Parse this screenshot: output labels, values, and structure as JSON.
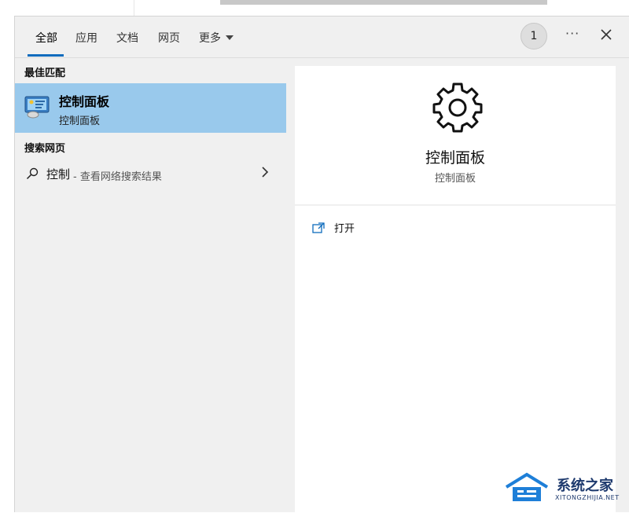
{
  "tabs": [
    {
      "label": "全部",
      "active": true
    },
    {
      "label": "应用"
    },
    {
      "label": "文档"
    },
    {
      "label": "网页"
    },
    {
      "label": "更多"
    }
  ],
  "header": {
    "avatar_text": "1",
    "more_label": "···"
  },
  "best_match": {
    "heading": "最佳匹配",
    "title": "控制面板",
    "subtitle": "控制面板",
    "icon": "control-panel-icon"
  },
  "web_search": {
    "heading": "搜索网页",
    "query": "控制",
    "hint": "- 查看网络搜索结果",
    "icon": "search-icon"
  },
  "detail": {
    "title": "控制面板",
    "subtitle": "控制面板",
    "icon": "gear-icon",
    "actions": [
      {
        "label": "打开",
        "icon": "open-icon"
      }
    ]
  },
  "watermark": {
    "text": "系统之家",
    "url": "XITONGZHIJIA.NET"
  },
  "colors": {
    "selection": "#99c9ec",
    "accent": "#0f6cbd"
  }
}
